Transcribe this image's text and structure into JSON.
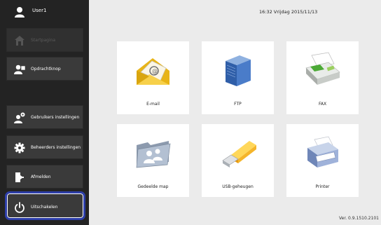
{
  "user": {
    "name": "User1"
  },
  "sidebar": {
    "items": [
      {
        "label": "Startpagina",
        "icon": "home-icon"
      },
      {
        "label": "Opdrachtknop",
        "icon": "user-task-icon"
      },
      {
        "label": "Gebruikers instellingen",
        "icon": "user-gear-icon"
      },
      {
        "label": "Beheerders instellingen",
        "icon": "gear-icon"
      },
      {
        "label": "Afmelden",
        "icon": "logout-icon"
      },
      {
        "label": "Uitschakelen",
        "icon": "power-icon"
      }
    ]
  },
  "clock": "16:32 Vrijdag 2015/11/13",
  "tiles": [
    {
      "label": "E-mail",
      "icon": "email-envelope-icon"
    },
    {
      "label": "FTP",
      "icon": "ftp-server-icon"
    },
    {
      "label": "FAX",
      "icon": "fax-machine-icon"
    },
    {
      "label": "Gedeelde map",
      "icon": "shared-folder-icon"
    },
    {
      "label": "USB-geheugen",
      "icon": "usb-drive-icon"
    },
    {
      "label": "Printer",
      "icon": "printer-icon"
    }
  ],
  "version": "Ver. 0.9.1510.2101",
  "colors": {
    "sidebar_bg": "#232323",
    "selection_border": "#2d3ea8",
    "main_bg": "#ebebeb"
  }
}
